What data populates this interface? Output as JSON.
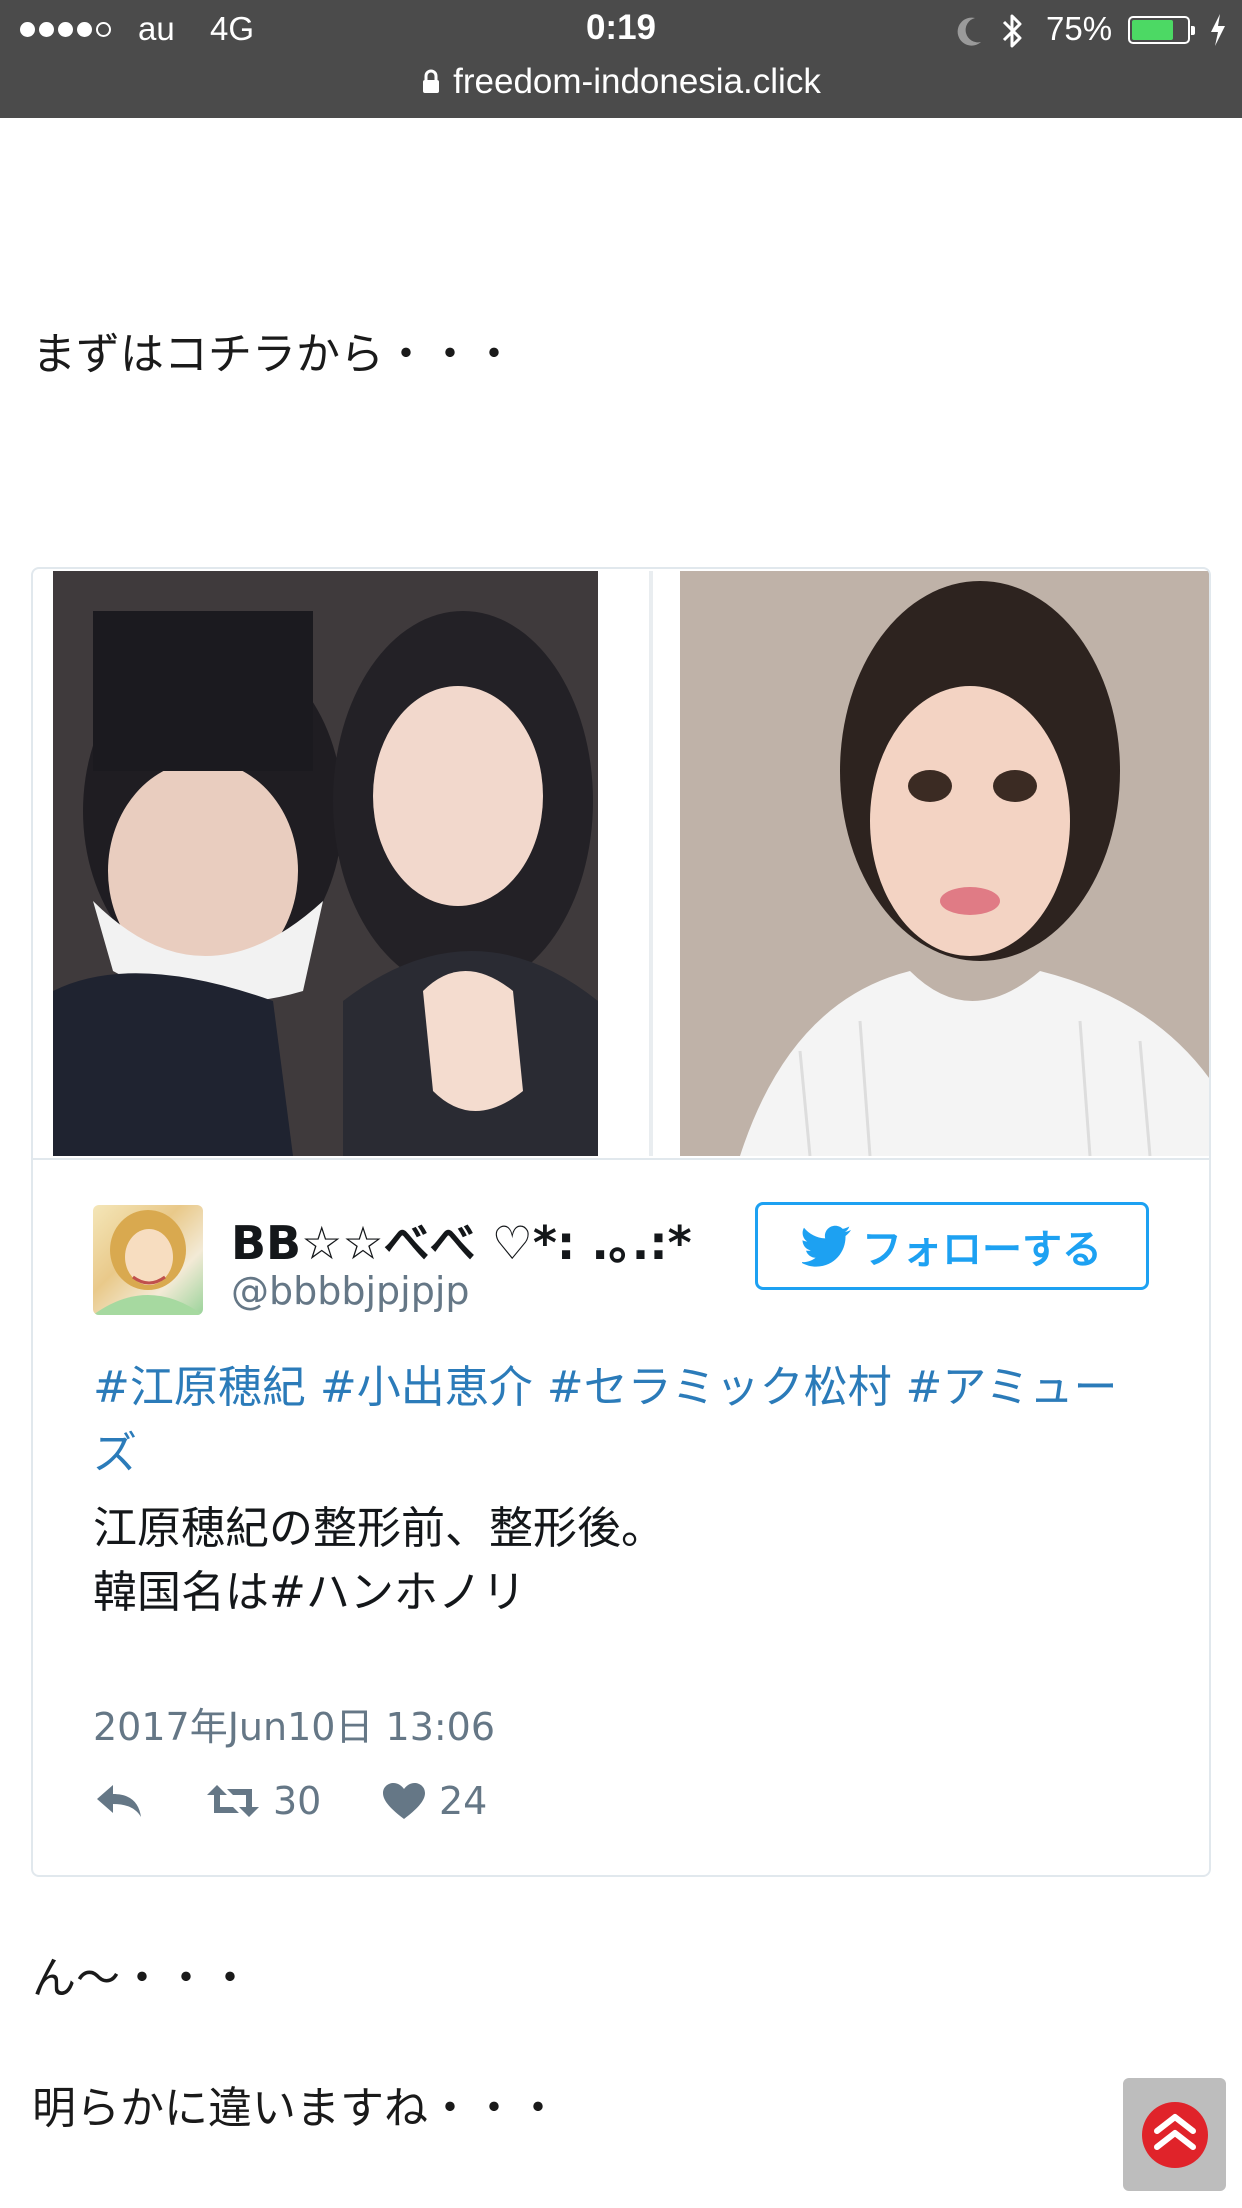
{
  "status_bar": {
    "carrier": "au",
    "network": "4G",
    "time": "0:19",
    "battery_percent": "75%",
    "battery_level": 0.75,
    "battery_color": "#4cd964"
  },
  "url_bar": {
    "domain": "freedom-indonesia.click",
    "icon": "lock-icon"
  },
  "article": {
    "intro": "まずはコチラから・・・",
    "after1": "ん〜・・・",
    "after2": "明らかに違いますね・・・"
  },
  "tweet": {
    "display_name": "BB☆☆べべ ♡*: .｡.:*",
    "handle": "@bbbbjpjpjp",
    "follow_label": "フォローする",
    "tags": "#江原穂紀 #小出恵介 #セラミック松村 #アミューズ",
    "body_lines": [
      "江原穂紀の整形前、整形後。",
      "韓国名は#ハンホノリ"
    ],
    "date": "2017年Jun10日 13:06",
    "retweet_count": "30",
    "like_count": "24",
    "accent_color": "#1da1f2",
    "link_color": "#2b7bb9"
  },
  "icons": [
    "lock-icon",
    "moon-icon",
    "bluetooth-icon",
    "charging-bolt-icon",
    "info-icon",
    "twitter-bird-icon",
    "reply-icon",
    "retweet-icon",
    "heart-icon",
    "scroll-to-top-icon"
  ]
}
